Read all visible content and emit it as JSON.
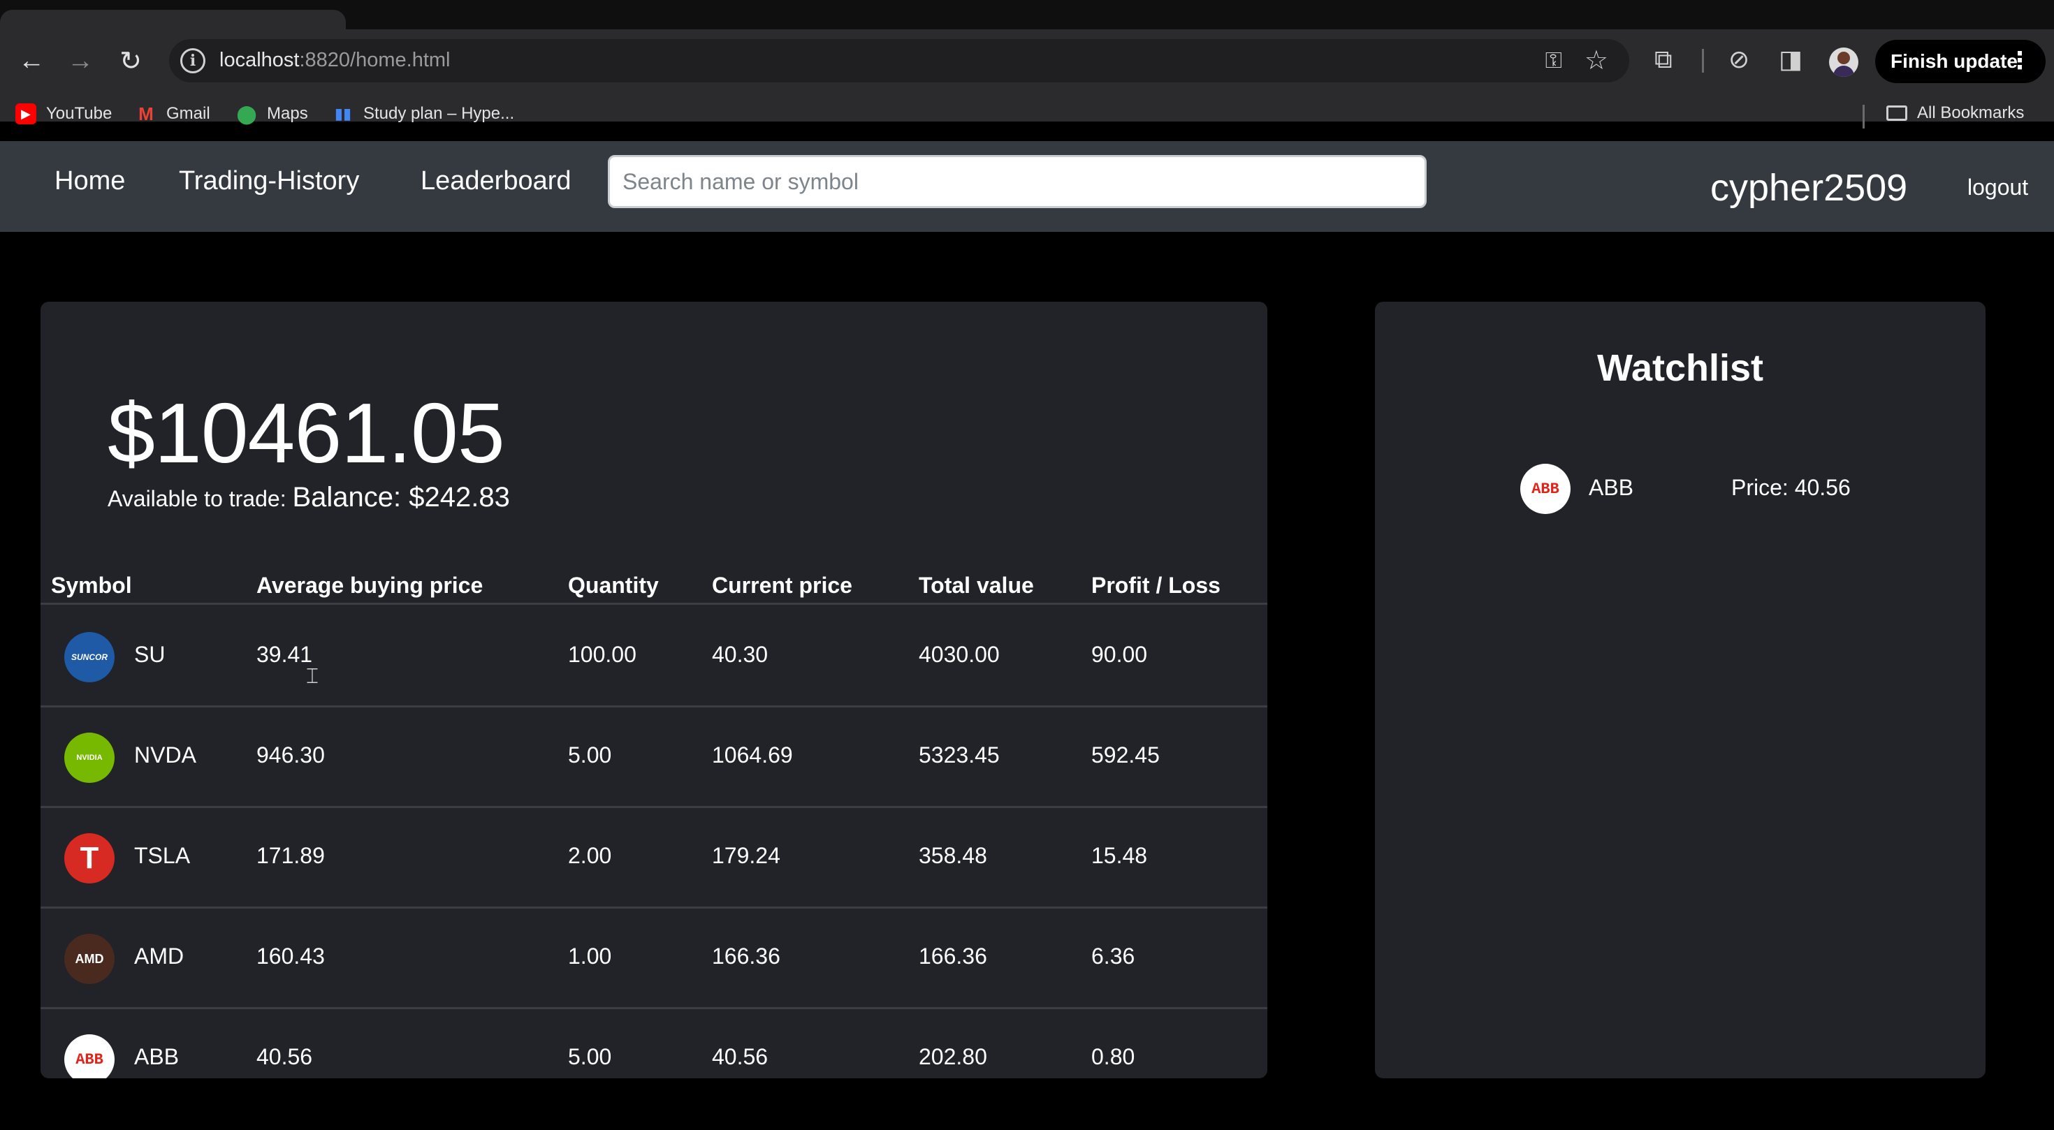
{
  "browser": {
    "url_host": "localhost",
    "url_rest": ":8820/home.html",
    "finish_update": "Finish update",
    "bookmarks": [
      "YouTube",
      "Gmail",
      "Maps",
      "Study plan – Hype..."
    ],
    "all_bookmarks": "All Bookmarks"
  },
  "nav": {
    "home": "Home",
    "history": "Trading-History",
    "leaderboard": "Leaderboard",
    "search_placeholder": "Search name or symbol",
    "username": "cypher2509",
    "logout": "logout"
  },
  "portfolio": {
    "total_value": "$10461.05",
    "available_label": "Available to trade:",
    "balance": "Balance: $242.83",
    "columns": [
      "Symbol",
      "Average buying price",
      "Quantity",
      "Current price",
      "Total value",
      "Profit / Loss"
    ],
    "rows": [
      {
        "symbol": "SU",
        "logo_text": "SUNCOR",
        "avg": "39.41",
        "qty": "100.00",
        "current": "40.30",
        "total": "4030.00",
        "pl": "90.00"
      },
      {
        "symbol": "NVDA",
        "logo_text": "NVIDIA",
        "avg": "946.30",
        "qty": "5.00",
        "current": "1064.69",
        "total": "5323.45",
        "pl": "592.45"
      },
      {
        "symbol": "TSLA",
        "logo_text": "T",
        "avg": "171.89",
        "qty": "2.00",
        "current": "179.24",
        "total": "358.48",
        "pl": "15.48"
      },
      {
        "symbol": "AMD",
        "logo_text": "AMD",
        "avg": "160.43",
        "qty": "1.00",
        "current": "166.36",
        "total": "166.36",
        "pl": "6.36"
      },
      {
        "symbol": "ABB",
        "logo_text": "ABB",
        "avg": "40.56",
        "qty": "5.00",
        "current": "40.56",
        "total": "202.80",
        "pl": "0.80"
      }
    ]
  },
  "watchlist": {
    "title": "Watchlist",
    "items": [
      {
        "symbol": "ABB",
        "logo_text": "ABB",
        "price": "Price: 40.56"
      }
    ]
  }
}
